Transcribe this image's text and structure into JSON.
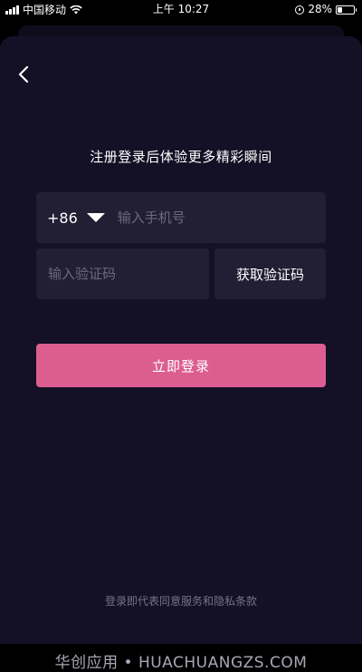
{
  "status_bar": {
    "carrier": "中国移动",
    "time": "上午 10:27",
    "battery": "28%",
    "battery_level": 0.28,
    "icons": [
      "signal-icon",
      "wifi-icon",
      "orientation-lock-icon",
      "battery-icon"
    ]
  },
  "nav": {
    "back_icon": "chevron-left-icon"
  },
  "headline": "注册登录后体验更多精彩瞬间",
  "form": {
    "country_code": "+86",
    "phone_placeholder": "输入手机号",
    "code_placeholder": "输入验证码",
    "get_code_label": "获取验证码",
    "login_label": "立即登录"
  },
  "footer": {
    "terms": "登录即代表同意服务和隐私条款",
    "watermark": "华创应用 • HUACHUANGZS.COM"
  },
  "colors": {
    "background": "#141025",
    "field": "#221e33",
    "accent": "#dc5e91"
  }
}
